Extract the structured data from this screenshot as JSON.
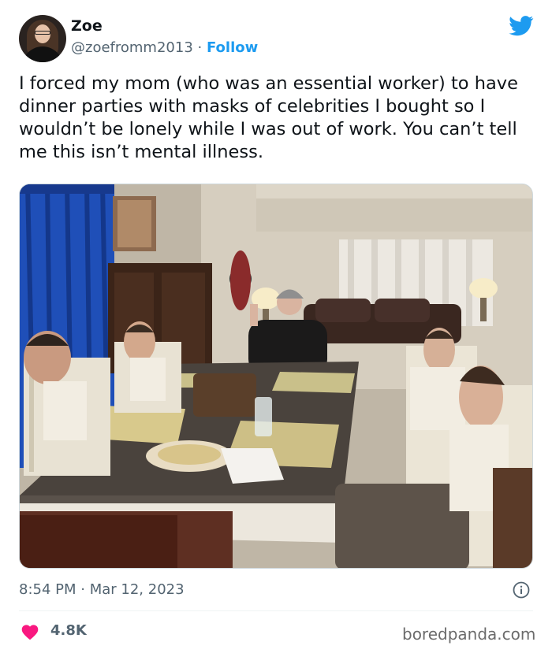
{
  "tweet": {
    "author_name": "Zoe",
    "author_handle": "@zoefromm2013",
    "separator": "·",
    "follow_label": "Follow",
    "text": "I forced my mom (who was an essential worker) to have dinner parties with masks of celebrities I bought so I wouldn’t be lonely while I was out of work. You can’t tell me this isn’t mental illness.",
    "time": "8:54 PM",
    "date": "Mar 12, 2023",
    "likes": "4.8K"
  },
  "icons": {
    "brand": "twitter-bird-icon",
    "info": "info-icon",
    "like": "heart-icon"
  },
  "footer": {
    "watermark": "boredpanda.com"
  },
  "colors": {
    "accent": "#1d9bf0",
    "heart": "#f91880",
    "secondary_text": "#536471"
  }
}
